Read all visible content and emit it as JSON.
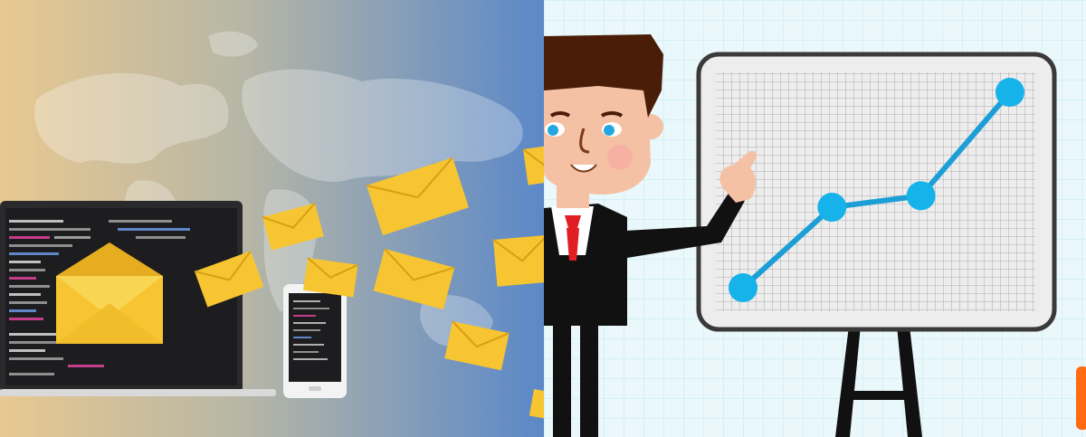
{
  "panels": [
    {
      "id": "email-marketing",
      "depicts": [
        "world-map",
        "laptop",
        "envelope",
        "smartphone",
        "flying-envelopes"
      ],
      "colors": {
        "gradient_start": "#e8c891",
        "gradient_end": "#5b88c8",
        "envelope": "#f6c531",
        "screen": "#1d1d1f"
      }
    },
    {
      "id": "business-presentation",
      "depicts": [
        "businessman",
        "whiteboard-easel",
        "line-chart"
      ],
      "colors": {
        "background": "#eaf8fb",
        "grid": "#c7eaf2",
        "suit": "#111111",
        "tie": "#e01e24",
        "chart_line": "#1c9fd6",
        "chart_point": "#16b2ea"
      }
    }
  ],
  "chart_data": {
    "type": "line",
    "x": [
      1,
      2,
      3,
      4
    ],
    "values": [
      1,
      2.4,
      2.6,
      4.4
    ]
  }
}
